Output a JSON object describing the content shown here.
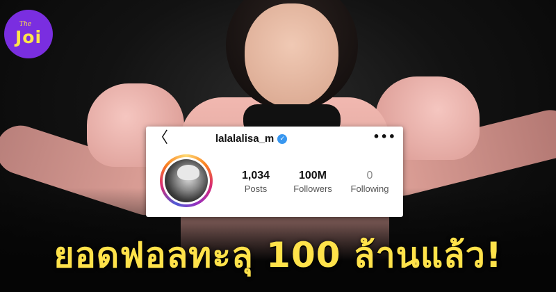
{
  "logo": {
    "prefix": "The",
    "name": "Joi"
  },
  "profile": {
    "username": "lalalalisa_m",
    "verified_glyph": "✓",
    "back_glyph": "〈",
    "more_glyph": "•••",
    "stats": {
      "posts": {
        "value": "1,034",
        "label": "Posts"
      },
      "followers": {
        "value": "100M",
        "label": "Followers"
      },
      "following": {
        "value": "0",
        "label": "Following"
      }
    }
  },
  "headline": "ยอดฟอลทะลุ 100 ล้านแล้ว!",
  "colors": {
    "headline": "#ffe24a",
    "logo_bg": "#7a2ee0",
    "verified": "#3897f0"
  }
}
